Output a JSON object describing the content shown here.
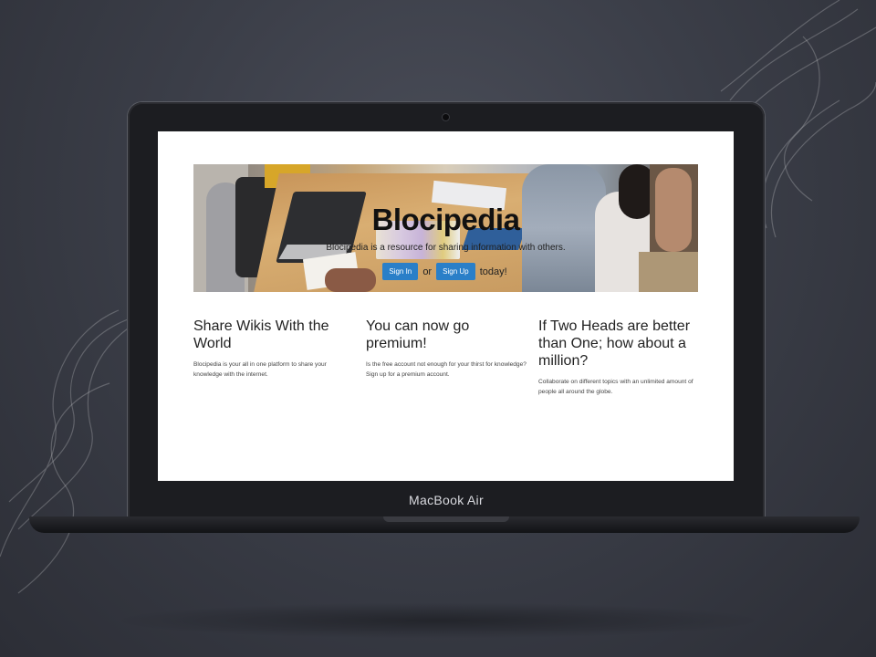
{
  "device": {
    "label": "MacBook Air"
  },
  "hero": {
    "title": "Blocipedia",
    "subtitle": "Blocipedia is a resource for sharing information with others.",
    "sign_in_label": "Sign In",
    "or_label": "or",
    "sign_up_label": "Sign Up",
    "today_label": "today!"
  },
  "features": [
    {
      "heading": "Share Wikis With the World",
      "body": "Blocipedia is your all in one platform to share your knowledge with the internet."
    },
    {
      "heading": "You can now go premium!",
      "body": "Is the free account not enough for your thirst for knowledge? Sign up for a premium account."
    },
    {
      "heading": "If Two Heads are better than One; how about a million?",
      "body": "Collaborate on different topics with an unlimited amount of people all around the globe."
    }
  ],
  "colors": {
    "button": "#2a7fc8",
    "background": "#3b3e48",
    "bezel": "#1c1d21"
  },
  "icons": {
    "camera": "camera-icon"
  }
}
